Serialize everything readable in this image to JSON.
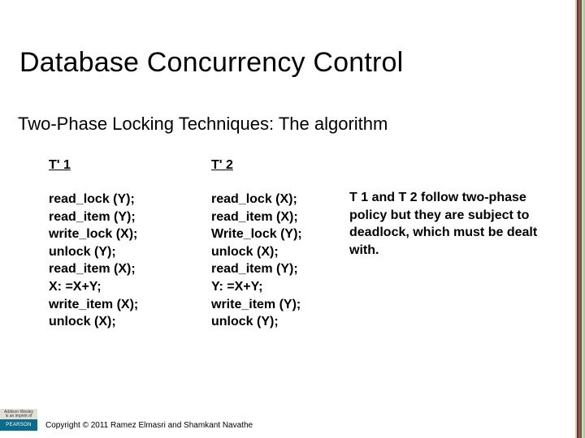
{
  "title": "Database Concurrency Control",
  "subtitle": "Two-Phase Locking Techniques: The algorithm",
  "columns": {
    "t1_header": "T' 1",
    "t2_header": "T' 2",
    "t1_ops": "read_lock (Y);\nread_item (Y);\nwrite_lock (X);\nunlock (Y);\nread_item (X);\nX: =X+Y;\nwrite_item (X);\nunlock (X);",
    "t2_ops": "read_lock (X);\nread_item (X);\nWrite_lock (Y);\nunlock (X);\nread_item (Y);\nY: =X+Y;\nwrite_item (Y);\nunlock (Y);",
    "note": "T 1 and T 2 follow two-phase policy but they are subject to deadlock, which must be dealt with."
  },
  "footer": {
    "aw_line1": "Addison-Wesley",
    "aw_line2": "is an imprint of",
    "pearson": "PEARSON",
    "copyright": "Copyright © 2011 Ramez Elmasri and Shamkant Navathe"
  }
}
